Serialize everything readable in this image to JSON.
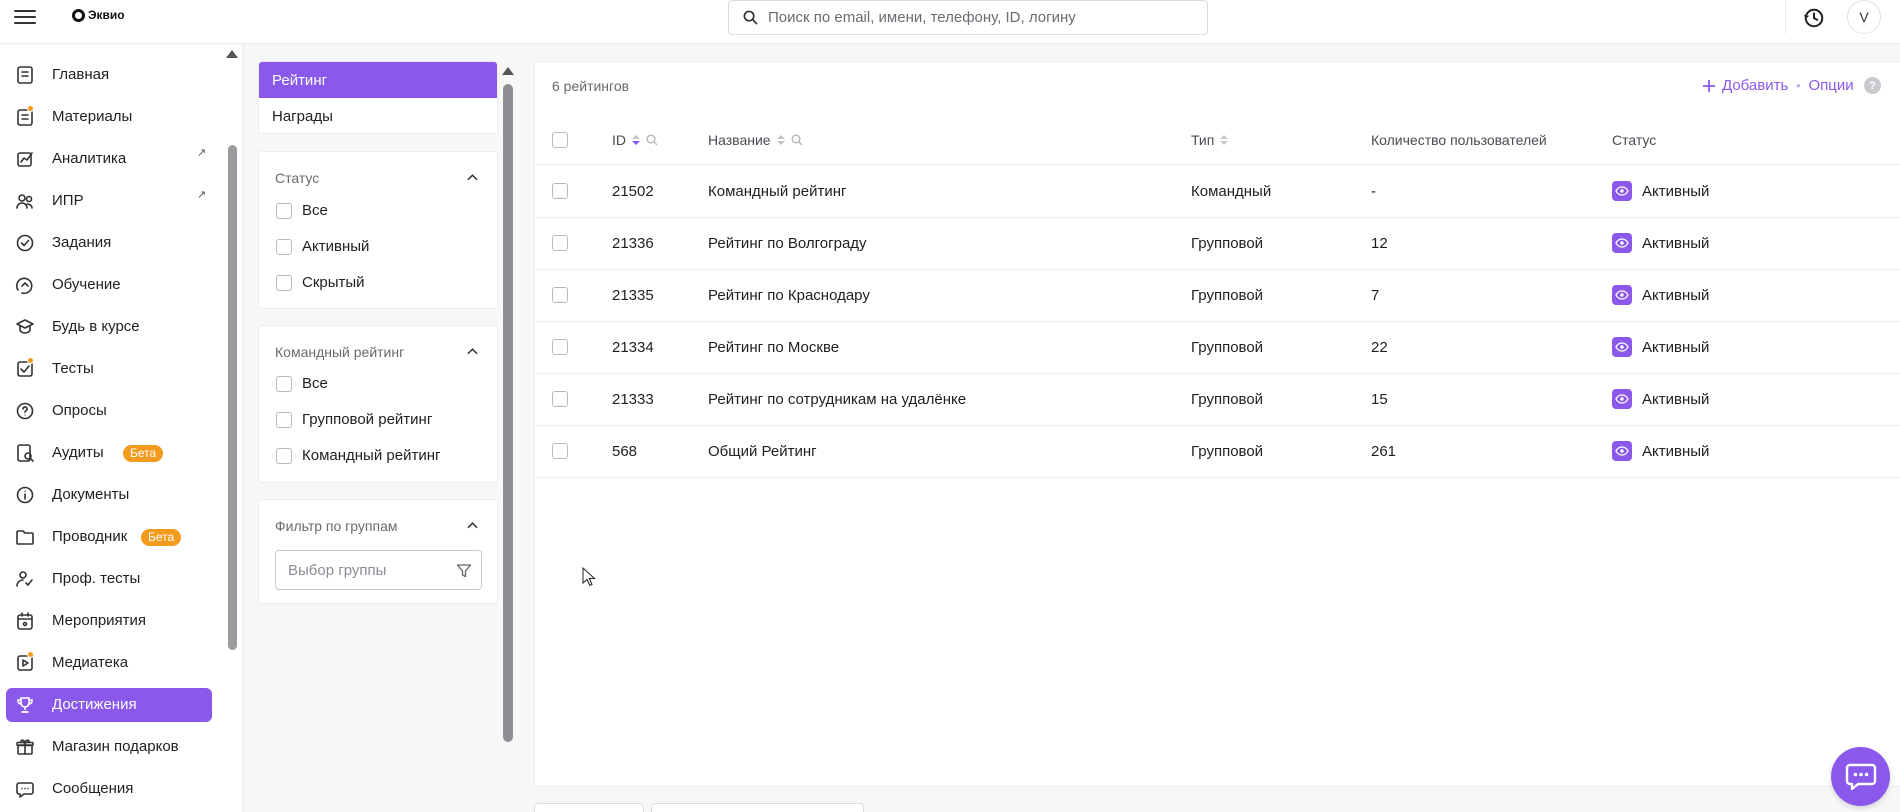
{
  "app": {
    "logo_text": "Эквио",
    "search_placeholder": "Поиск по email, имени, телефону, ID, логину",
    "avatar_initial": "V",
    "accent_color": "#8a58ea",
    "badge_color": "#f29b1d"
  },
  "sidebar": {
    "items": [
      {
        "label": "Главная",
        "icon": "home-doc-icon"
      },
      {
        "label": "Материалы",
        "icon": "materials-icon",
        "dot": true
      },
      {
        "label": "Аналитика",
        "icon": "analytics-icon",
        "external": true
      },
      {
        "label": "ИПР",
        "icon": "people-icon",
        "external": true
      },
      {
        "label": "Задания",
        "icon": "task-check-icon"
      },
      {
        "label": "Обучение",
        "icon": "learning-icon"
      },
      {
        "label": "Будь в курсе",
        "icon": "graduation-cap-icon"
      },
      {
        "label": "Тесты",
        "icon": "tests-icon",
        "dot": true
      },
      {
        "label": "Опросы",
        "icon": "survey-icon"
      },
      {
        "label": "Аудиты",
        "icon": "audit-icon",
        "badge": "Бета"
      },
      {
        "label": "Документы",
        "icon": "info-icon"
      },
      {
        "label": "Проводник",
        "icon": "folder-icon",
        "badge": "Бета"
      },
      {
        "label": "Проф. тесты",
        "icon": "user-check-icon"
      },
      {
        "label": "Мероприятия",
        "icon": "calendar-icon"
      },
      {
        "label": "Медиатека",
        "icon": "media-icon",
        "dot": true
      },
      {
        "label": "Достижения",
        "icon": "trophy-icon",
        "active": true
      },
      {
        "label": "Магазин подарков",
        "icon": "gift-icon"
      },
      {
        "label": "Сообщения",
        "icon": "chat-icon"
      }
    ]
  },
  "panel": {
    "tabs": [
      {
        "label": "Рейтинг",
        "active": true
      },
      {
        "label": "Награды",
        "active": false
      }
    ],
    "status_filter": {
      "title": "Статус",
      "options": [
        "Все",
        "Активный",
        "Скрытый"
      ]
    },
    "team_filter": {
      "title": "Командный рейтинг",
      "options": [
        "Все",
        "Групповой рейтинг",
        "Командный рейтинг"
      ]
    },
    "group_filter": {
      "title": "Фильтр по группам",
      "placeholder": "Выбор группы"
    }
  },
  "table": {
    "count_label": "6 рейтингов",
    "add_label": "Добавить",
    "options_label": "Опции",
    "help_label": "?",
    "columns": {
      "id": "ID",
      "name": "Название",
      "type": "Тип",
      "users": "Количество пользователей",
      "status": "Статус"
    },
    "rows": [
      {
        "id": "21502",
        "name": "Командный рейтинг",
        "type": "Командный",
        "users": "-",
        "status": "Активный"
      },
      {
        "id": "21336",
        "name": "Рейтинг по Волгограду",
        "type": "Групповой",
        "users": "12",
        "status": "Активный"
      },
      {
        "id": "21335",
        "name": "Рейтинг по Краснодару",
        "type": "Групповой",
        "users": "7",
        "status": "Активный"
      },
      {
        "id": "21334",
        "name": "Рейтинг по Москве",
        "type": "Групповой",
        "users": "22",
        "status": "Активный"
      },
      {
        "id": "21333",
        "name": "Рейтинг по сотрудникам на удалёнке",
        "type": "Групповой",
        "users": "15",
        "status": "Активный"
      },
      {
        "id": "568",
        "name": "Общий Рейтинг",
        "type": "Групповой",
        "users": "261",
        "status": "Активный"
      }
    ]
  }
}
